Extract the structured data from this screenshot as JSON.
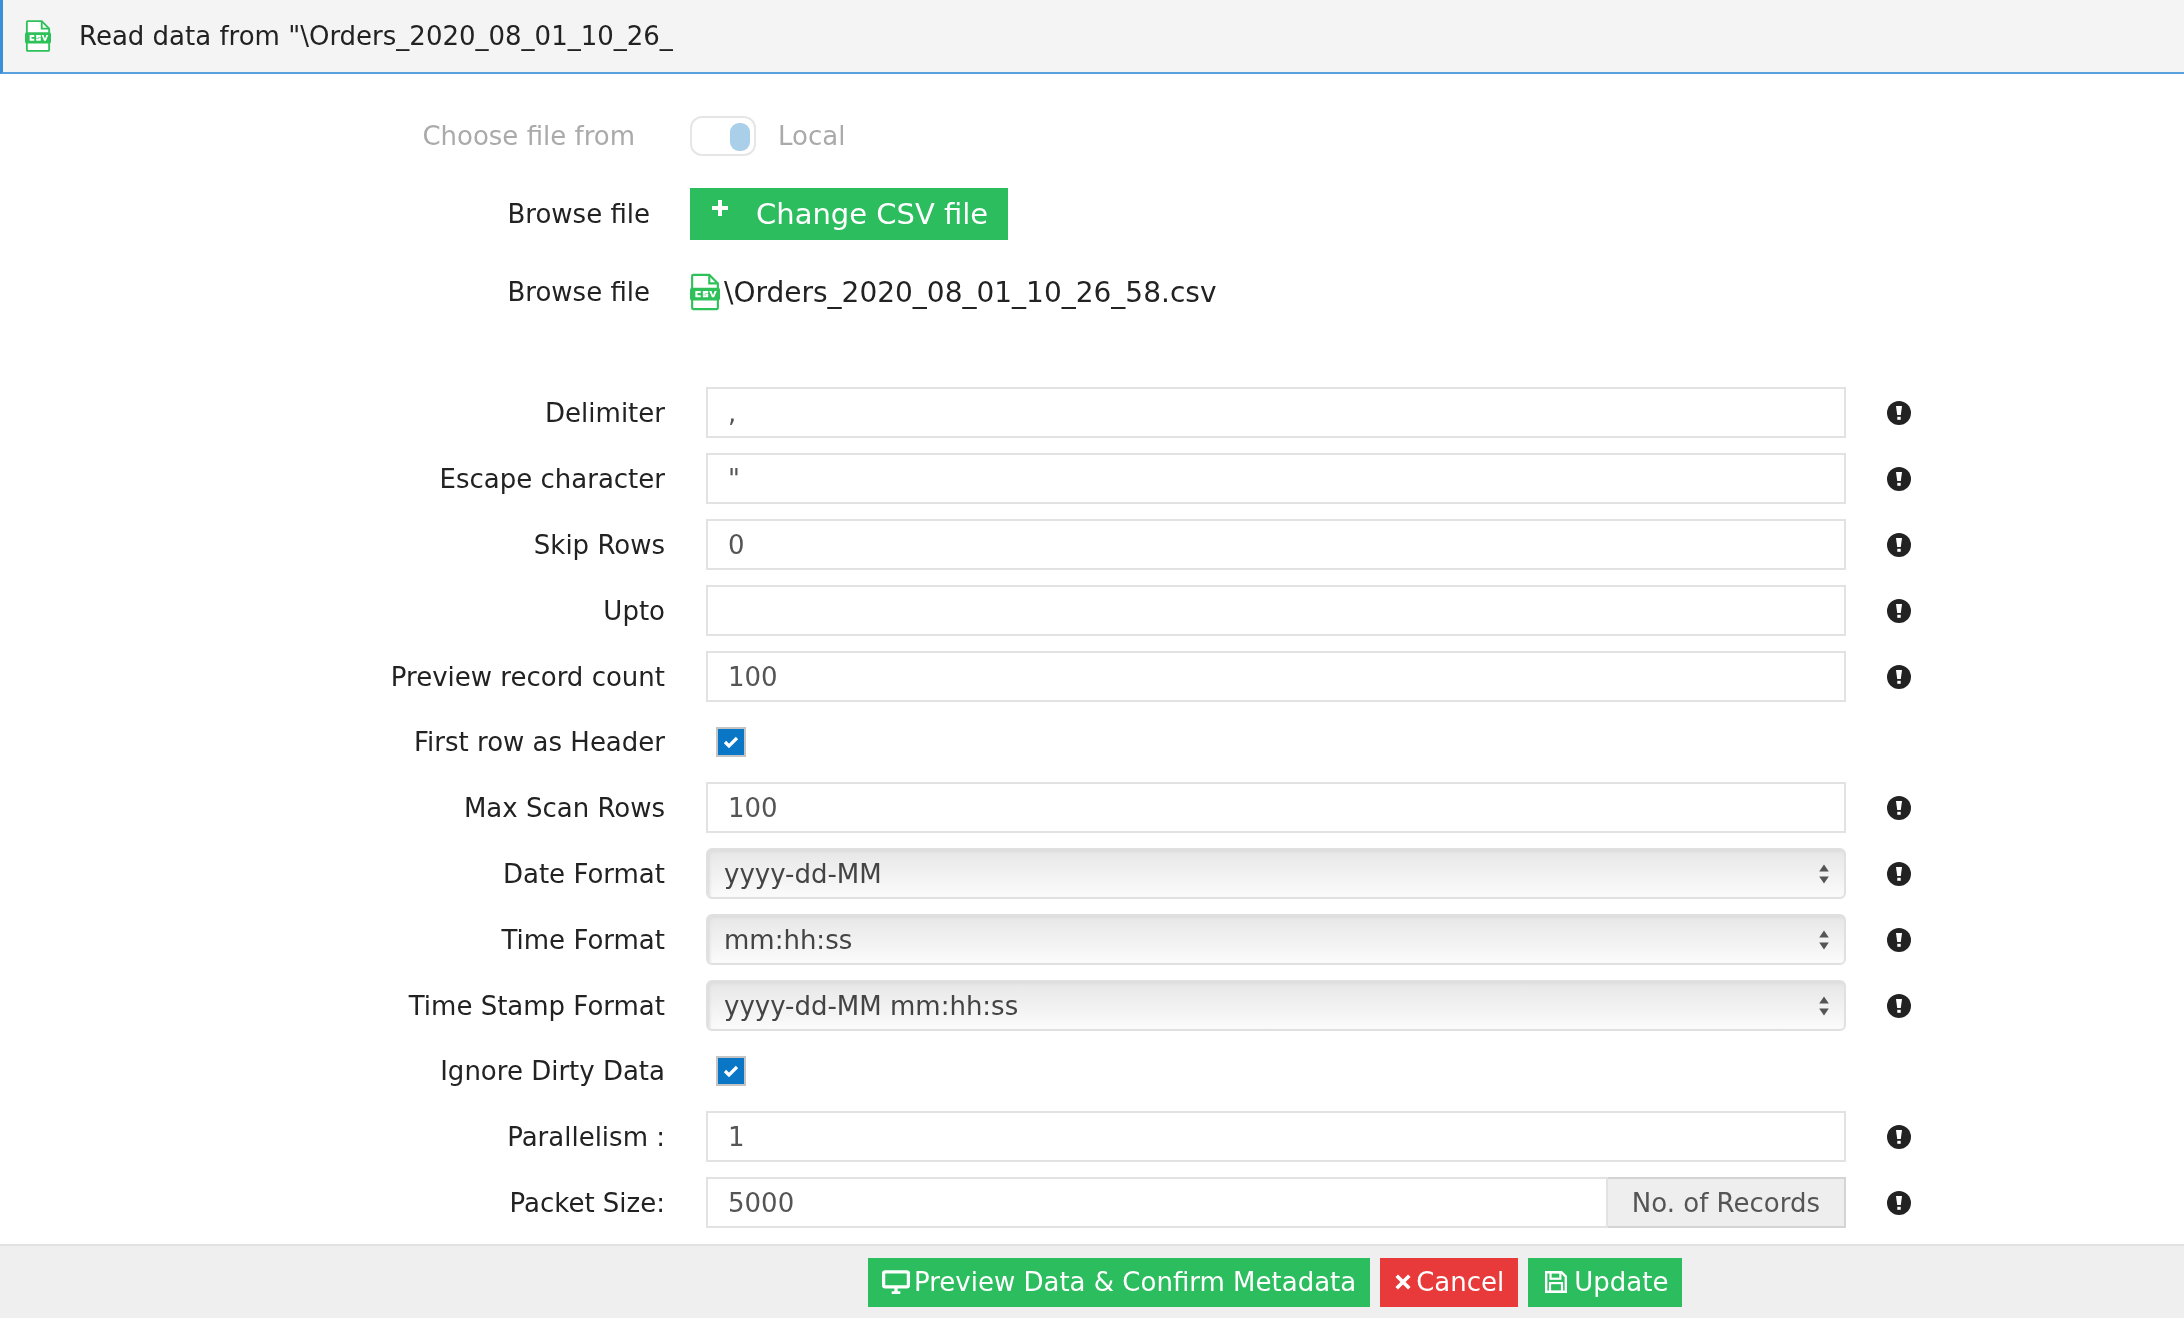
{
  "header": {
    "title": "Read data from \"\\Orders_2020_08_01_10_26_"
  },
  "source": {
    "label": "Choose file from",
    "toggle_label": "Local",
    "on": true,
    "disabled": true
  },
  "browse": {
    "label": "Browse file",
    "button": "Change CSV file"
  },
  "file": {
    "label": "Browse file",
    "name": "\\Orders_2020_08_01_10_26_58.csv"
  },
  "fields": [
    {
      "kind": "text",
      "label": "Delimiter",
      "value": ",",
      "info": true
    },
    {
      "kind": "text",
      "label": "Escape character",
      "value": "\"",
      "info": true
    },
    {
      "kind": "text",
      "label": "Skip Rows",
      "value": "0",
      "info": true
    },
    {
      "kind": "text",
      "label": "Upto",
      "info": true
    },
    {
      "kind": "text",
      "label": "Preview record count",
      "value": "100",
      "info": true
    },
    {
      "kind": "checkbox",
      "label": "First row as Header",
      "checked": true,
      "info": false
    },
    {
      "kind": "text",
      "label": "Max Scan Rows",
      "value": "100",
      "info": true
    },
    {
      "kind": "select",
      "label": "Date Format",
      "value": "yyyy-dd-MM",
      "info": true
    },
    {
      "kind": "select",
      "label": "Time Format",
      "value": "mm:hh:ss",
      "info": true
    },
    {
      "kind": "select",
      "label": "Time Stamp Format",
      "value": "yyyy-dd-MM mm:hh:ss",
      "info": true
    },
    {
      "kind": "checkbox",
      "label": "Ignore Dirty Data",
      "checked": true,
      "info": false
    },
    {
      "kind": "text",
      "label": "Parallelism :",
      "value": "1",
      "info": true
    },
    {
      "kind": "addon",
      "label": "Packet Size:",
      "value": "5000",
      "addon": "No. of Records",
      "info": true
    }
  ],
  "footer": [
    {
      "kind": "preview",
      "label": "Preview Data & Confirm Metadata"
    },
    {
      "kind": "cancel",
      "label": "Cancel"
    },
    {
      "kind": "update",
      "label": "Update"
    }
  ]
}
